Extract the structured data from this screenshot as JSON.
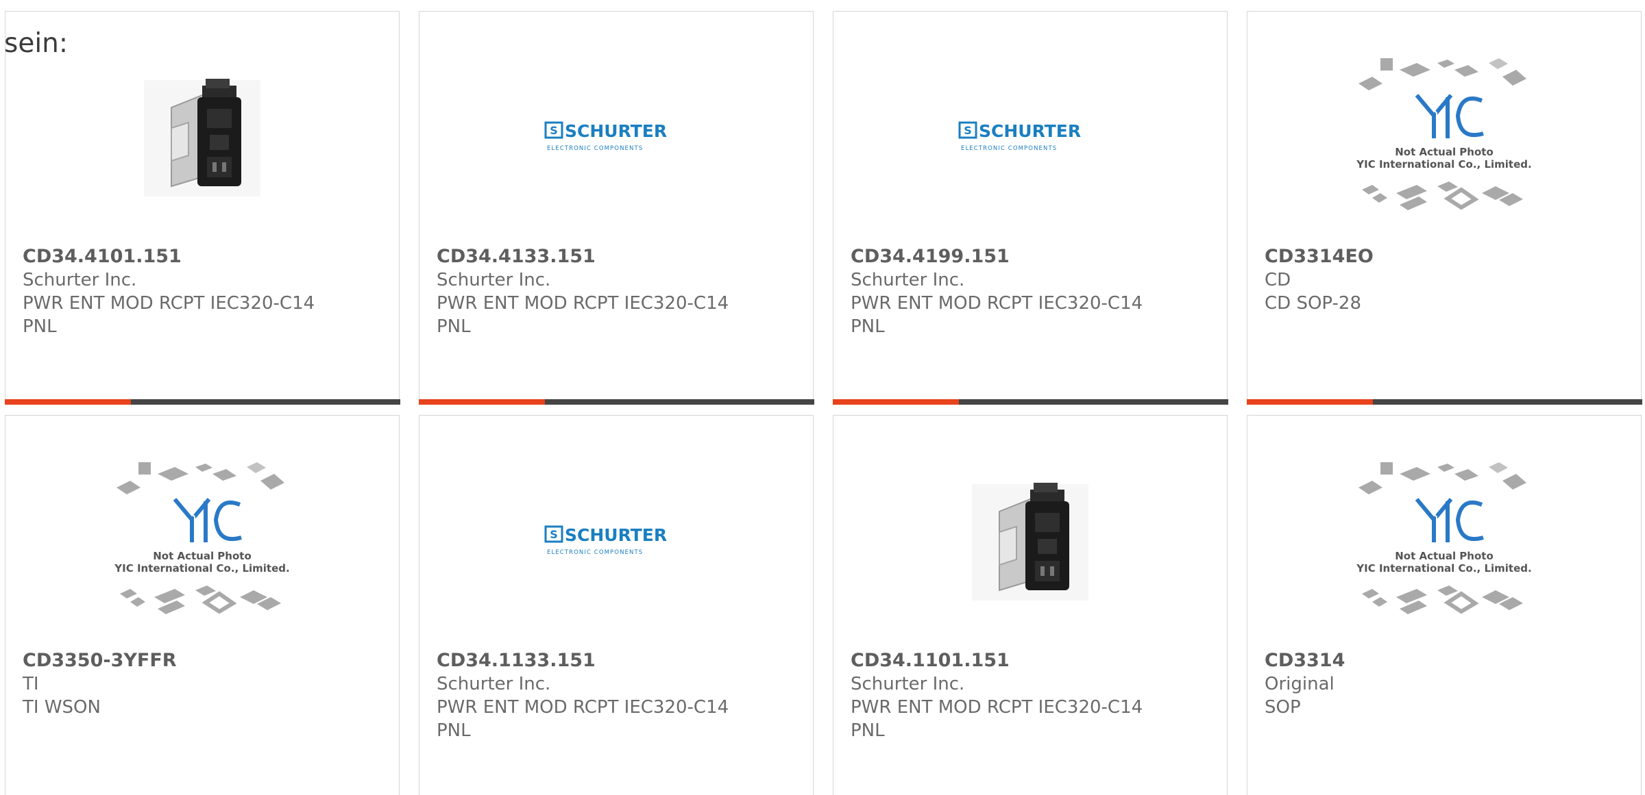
{
  "intro_text": "sein:",
  "colors": {
    "accent": "#e8431c",
    "bar": "#454545",
    "schurter_blue": "#1a7fc1",
    "yic_blue": "#2a79c7"
  },
  "products": [
    {
      "part": "CD34.4101.151",
      "line1": "Schurter Inc.",
      "line2": "PWR ENT MOD RCPT IEC320-C14",
      "line3": "PNL",
      "image": "power-entry-module"
    },
    {
      "part": "CD34.4133.151",
      "line1": "Schurter Inc.",
      "line2": "PWR ENT MOD RCPT IEC320-C14",
      "line3": "PNL",
      "image": "schurter-logo"
    },
    {
      "part": "CD34.4199.151",
      "line1": "Schurter Inc.",
      "line2": "PWR ENT MOD RCPT IEC320-C14",
      "line3": "PNL",
      "image": "schurter-logo"
    },
    {
      "part": "CD3314EO",
      "line1": "CD",
      "line2": "CD SOP-28",
      "line3": "",
      "image": "yic-placeholder"
    },
    {
      "part": "CD3350-3YFFR",
      "line1": "TI",
      "line2": "TI WSON",
      "line3": "",
      "image": "yic-placeholder"
    },
    {
      "part": "CD34.1133.151",
      "line1": "Schurter Inc.",
      "line2": "PWR ENT MOD RCPT IEC320-C14",
      "line3": "PNL",
      "image": "schurter-logo"
    },
    {
      "part": "CD34.1101.151",
      "line1": "Schurter Inc.",
      "line2": "PWR ENT MOD RCPT IEC320-C14",
      "line3": "PNL",
      "image": "power-entry-module"
    },
    {
      "part": "CD3314",
      "line1": "Original",
      "line2": "SOP",
      "line3": "",
      "image": "yic-placeholder"
    }
  ],
  "logo_text": {
    "schurter_brand": "SCHURTER",
    "schurter_sub": "ELECTRONIC COMPONENTS",
    "yic_note1": "Not Actual Photo",
    "yic_note2": "YIC International Co., Limited."
  }
}
